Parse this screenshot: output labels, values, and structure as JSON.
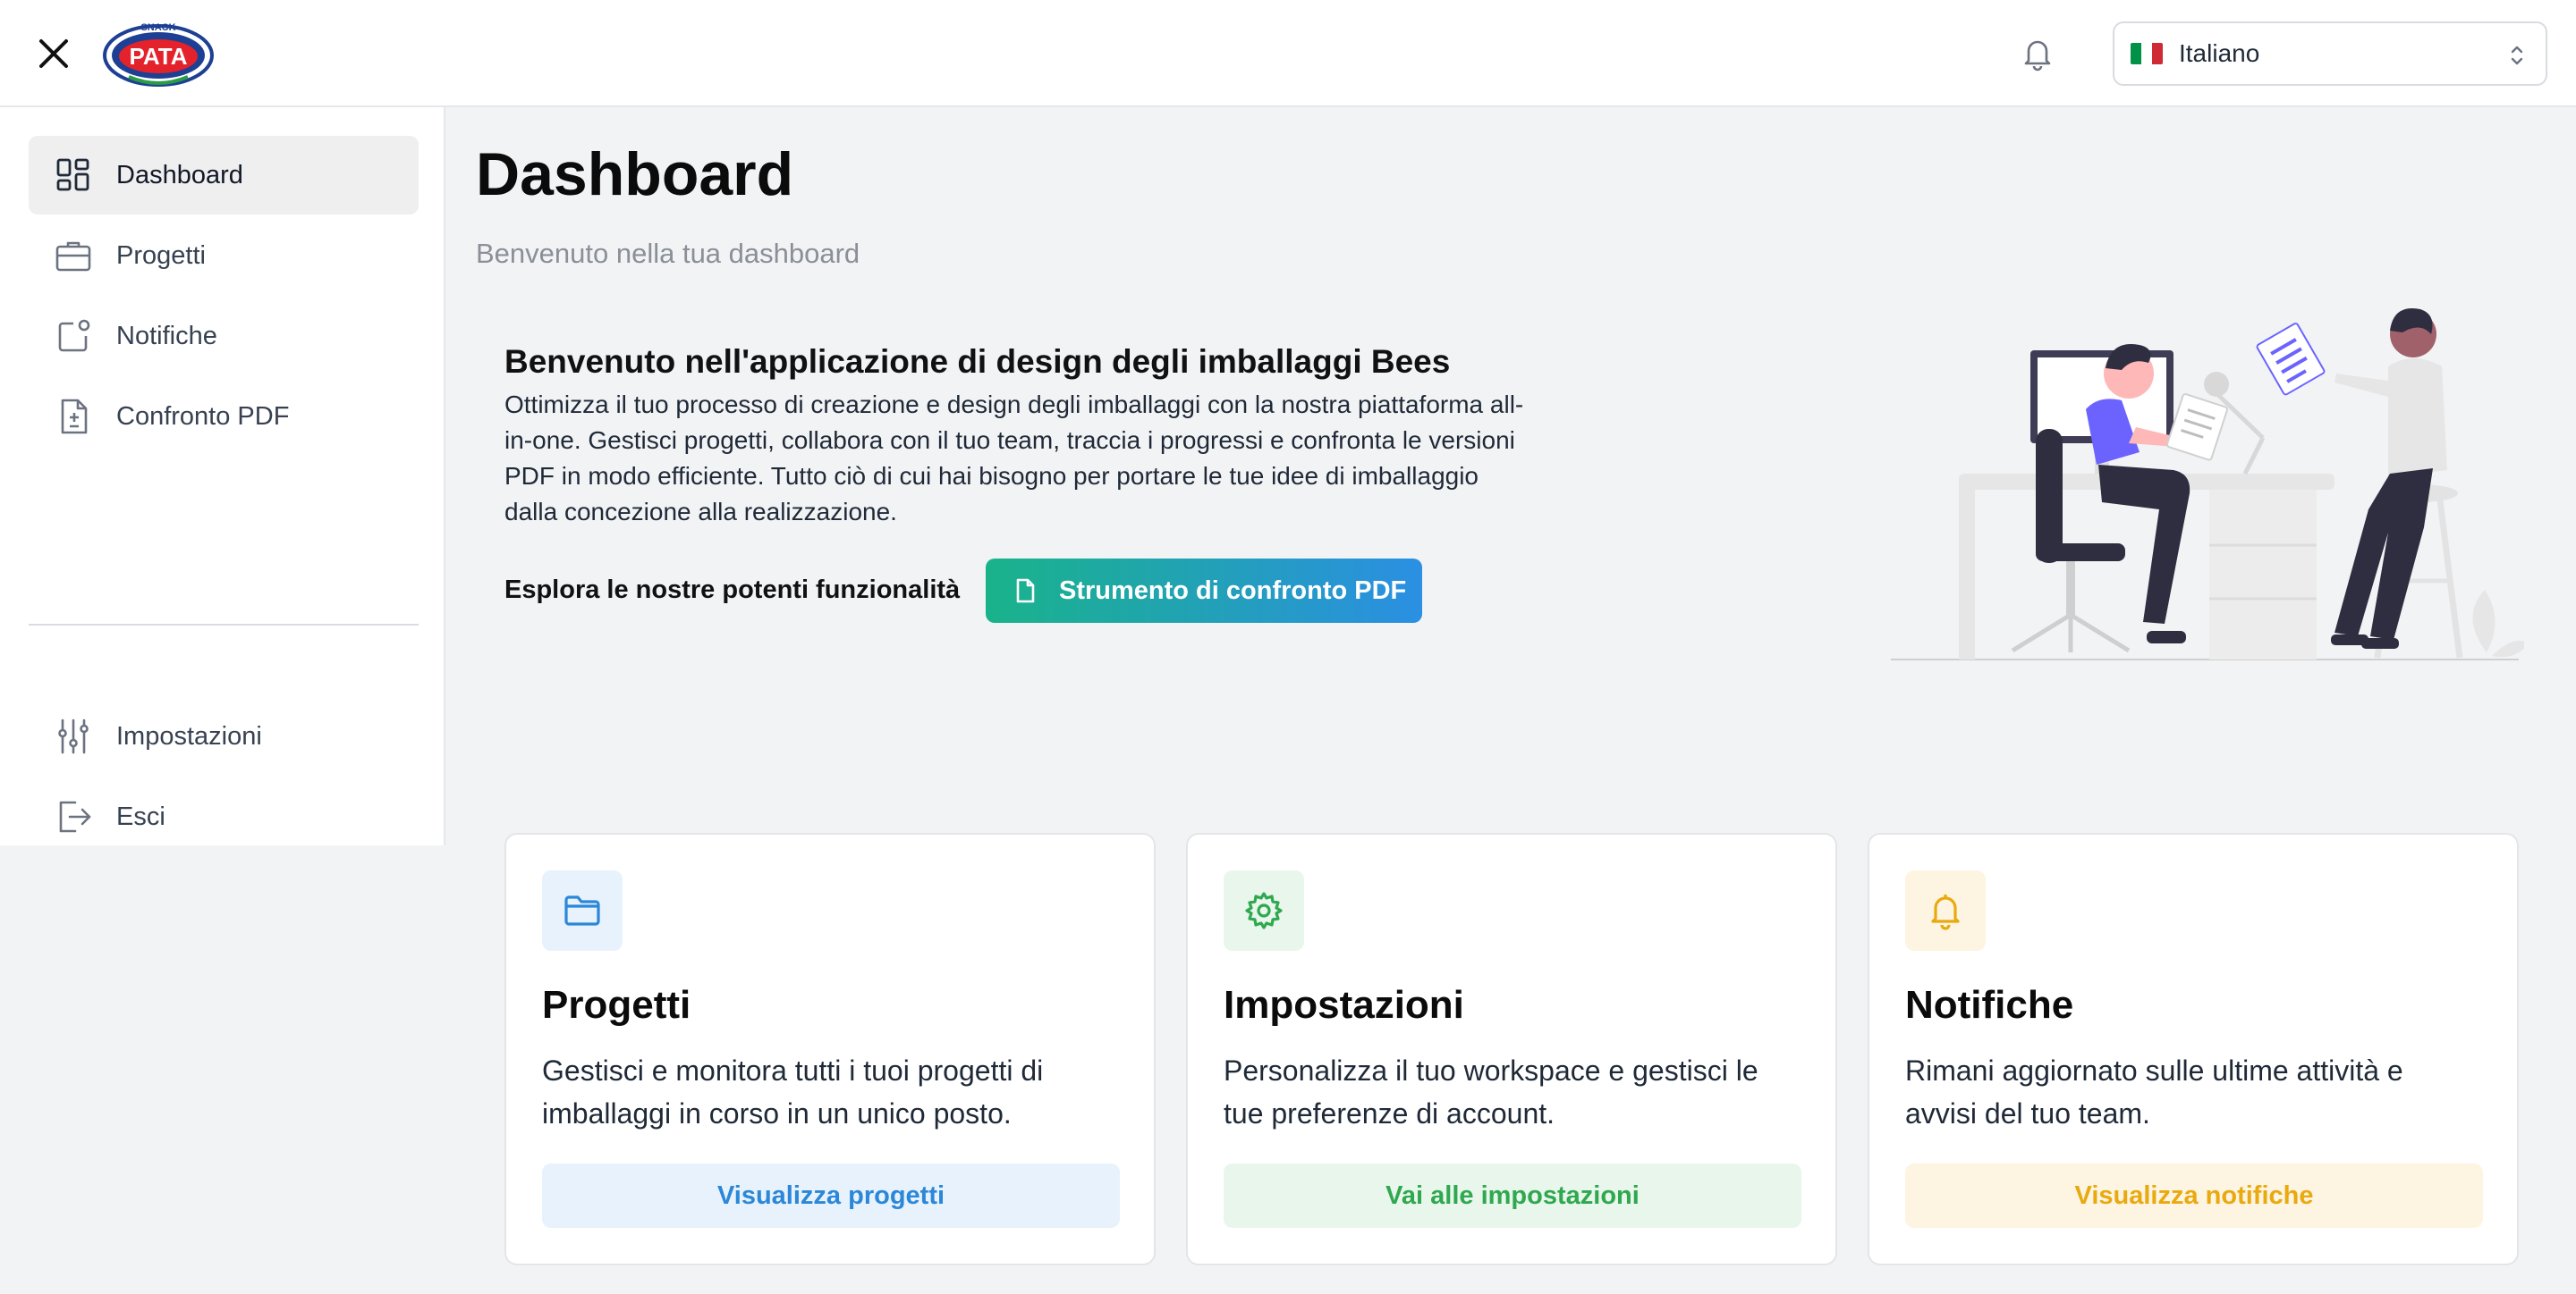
{
  "header": {
    "close_icon": "close-icon",
    "logo_top_text": "SNACK",
    "logo_text": "PATA",
    "notification_icon": "bell-icon",
    "language": {
      "selected": "Italiano",
      "flag_colors": [
        "#009246",
        "#ffffff",
        "#ce2b37"
      ]
    }
  },
  "sidebar": {
    "items": [
      {
        "label": "Dashboard",
        "icon": "dashboard-grid-icon",
        "active": true
      },
      {
        "label": "Progetti",
        "icon": "briefcase-icon"
      },
      {
        "label": "Notifiche",
        "icon": "notification-square-icon"
      },
      {
        "label": "Confronto PDF",
        "icon": "file-diff-icon"
      }
    ],
    "bottom_items": [
      {
        "label": "Impostazioni",
        "icon": "sliders-icon"
      },
      {
        "label": "Esci",
        "icon": "logout-icon"
      }
    ]
  },
  "main": {
    "title": "Dashboard",
    "subtitle": "Benvenuto nella tua dashboard",
    "welcome": {
      "title": "Benvenuto nell'applicazione di design degli imballaggi Bees",
      "lines": [
        "Ottimizza il tuo processo di creazione e design degli imballaggi con la nostra piattaforma all-",
        "in-one. Gestisci progetti, collabora con il tuo team, traccia i progressi e confronta le versioni",
        "PDF in modo efficiente. Tutto ciò di cui hai bisogno per portare le tue idee di imballaggio",
        "dalla concezione alla realizzazione."
      ],
      "explore_label": "Esplora le nostre potenti funzionalità",
      "pdf_button": "Strumento di confronto PDF"
    },
    "cards": [
      {
        "title": "Progetti",
        "desc_lines": [
          "Gestisci e monitora tutti i tuoi progetti di",
          "imballaggi in corso in un unico posto."
        ],
        "button": "Visualizza progetti",
        "icon": "folder-icon",
        "accent": "#2b87d8",
        "tint": "#e8f2fc"
      },
      {
        "title": "Impostazioni",
        "desc_lines": [
          "Personalizza il tuo workspace e gestisci le",
          "tue preferenze di account."
        ],
        "button": "Vai alle impostazioni",
        "icon": "gear-icon",
        "accent": "#2fa84f",
        "tint": "#e8f6ec"
      },
      {
        "title": "Notifiche",
        "desc_lines": [
          "Rimani aggiornato sulle ultime attività e",
          "avvisi del tuo team."
        ],
        "button": "Visualizza notifiche",
        "icon": "bell-icon",
        "accent": "#e9a90f",
        "tint": "#fdf5e2"
      }
    ]
  }
}
